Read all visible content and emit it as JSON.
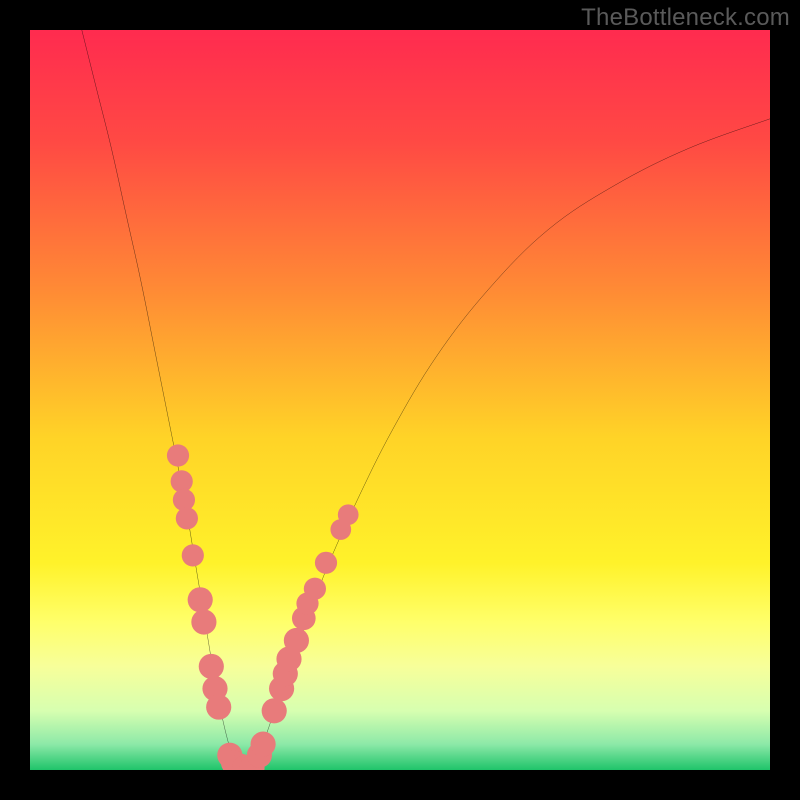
{
  "watermark": "TheBottleneck.com",
  "chart_data": {
    "type": "line",
    "title": "",
    "xlabel": "",
    "ylabel": "",
    "xlim": [
      0,
      100
    ],
    "ylim": [
      0,
      100
    ],
    "gradient_stops": [
      {
        "offset": 0.0,
        "color": "#ff2b4f"
      },
      {
        "offset": 0.15,
        "color": "#ff4944"
      },
      {
        "offset": 0.35,
        "color": "#ff8a35"
      },
      {
        "offset": 0.55,
        "color": "#ffd327"
      },
      {
        "offset": 0.72,
        "color": "#fff22a"
      },
      {
        "offset": 0.8,
        "color": "#ffff6a"
      },
      {
        "offset": 0.86,
        "color": "#f7ff9a"
      },
      {
        "offset": 0.92,
        "color": "#d7ffb0"
      },
      {
        "offset": 0.965,
        "color": "#8de9a8"
      },
      {
        "offset": 1.0,
        "color": "#1fc46a"
      }
    ],
    "series": [
      {
        "name": "left-branch",
        "x": [
          7,
          9,
          11,
          13,
          15,
          17,
          19,
          20,
          21,
          22,
          23,
          24,
          25,
          26,
          27,
          28
        ],
        "y": [
          100,
          92,
          84,
          75,
          66,
          56,
          46,
          41,
          36,
          30,
          24,
          18,
          12,
          7,
          3,
          0
        ]
      },
      {
        "name": "right-branch",
        "x": [
          30,
          32,
          34,
          37,
          40,
          44,
          49,
          55,
          62,
          70,
          79,
          89,
          100
        ],
        "y": [
          0,
          5,
          11,
          19,
          27,
          36,
          46,
          56,
          65,
          73,
          79,
          84,
          88
        ]
      }
    ],
    "marker_points": [
      {
        "x": 20.0,
        "y": 42.5,
        "r": 1.5
      },
      {
        "x": 20.5,
        "y": 39.0,
        "r": 1.5
      },
      {
        "x": 20.8,
        "y": 36.5,
        "r": 1.5
      },
      {
        "x": 21.2,
        "y": 34.0,
        "r": 1.5
      },
      {
        "x": 22.0,
        "y": 29.0,
        "r": 1.5
      },
      {
        "x": 23.0,
        "y": 23.0,
        "r": 1.7
      },
      {
        "x": 23.5,
        "y": 20.0,
        "r": 1.7
      },
      {
        "x": 24.5,
        "y": 14.0,
        "r": 1.7
      },
      {
        "x": 25.0,
        "y": 11.0,
        "r": 1.7
      },
      {
        "x": 25.5,
        "y": 8.5,
        "r": 1.7
      },
      {
        "x": 27.0,
        "y": 2.0,
        "r": 1.7
      },
      {
        "x": 27.5,
        "y": 1.0,
        "r": 1.7
      },
      {
        "x": 28.5,
        "y": 0.5,
        "r": 1.7
      },
      {
        "x": 29.0,
        "y": 0.3,
        "r": 1.7
      },
      {
        "x": 30.0,
        "y": 0.3,
        "r": 1.7
      },
      {
        "x": 31.0,
        "y": 2.0,
        "r": 1.7
      },
      {
        "x": 31.5,
        "y": 3.5,
        "r": 1.7
      },
      {
        "x": 33.0,
        "y": 8.0,
        "r": 1.7
      },
      {
        "x": 34.0,
        "y": 11.0,
        "r": 1.7
      },
      {
        "x": 34.5,
        "y": 13.0,
        "r": 1.7
      },
      {
        "x": 35.0,
        "y": 15.0,
        "r": 1.7
      },
      {
        "x": 36.0,
        "y": 17.5,
        "r": 1.7
      },
      {
        "x": 37.0,
        "y": 20.5,
        "r": 1.6
      },
      {
        "x": 37.5,
        "y": 22.5,
        "r": 1.5
      },
      {
        "x": 38.5,
        "y": 24.5,
        "r": 1.5
      },
      {
        "x": 40.0,
        "y": 28.0,
        "r": 1.5
      },
      {
        "x": 42.0,
        "y": 32.5,
        "r": 1.4
      },
      {
        "x": 43.0,
        "y": 34.5,
        "r": 1.4
      }
    ],
    "marker_color": "#e87b7b",
    "curve_color": "#000000",
    "curve_width": 2.2
  }
}
